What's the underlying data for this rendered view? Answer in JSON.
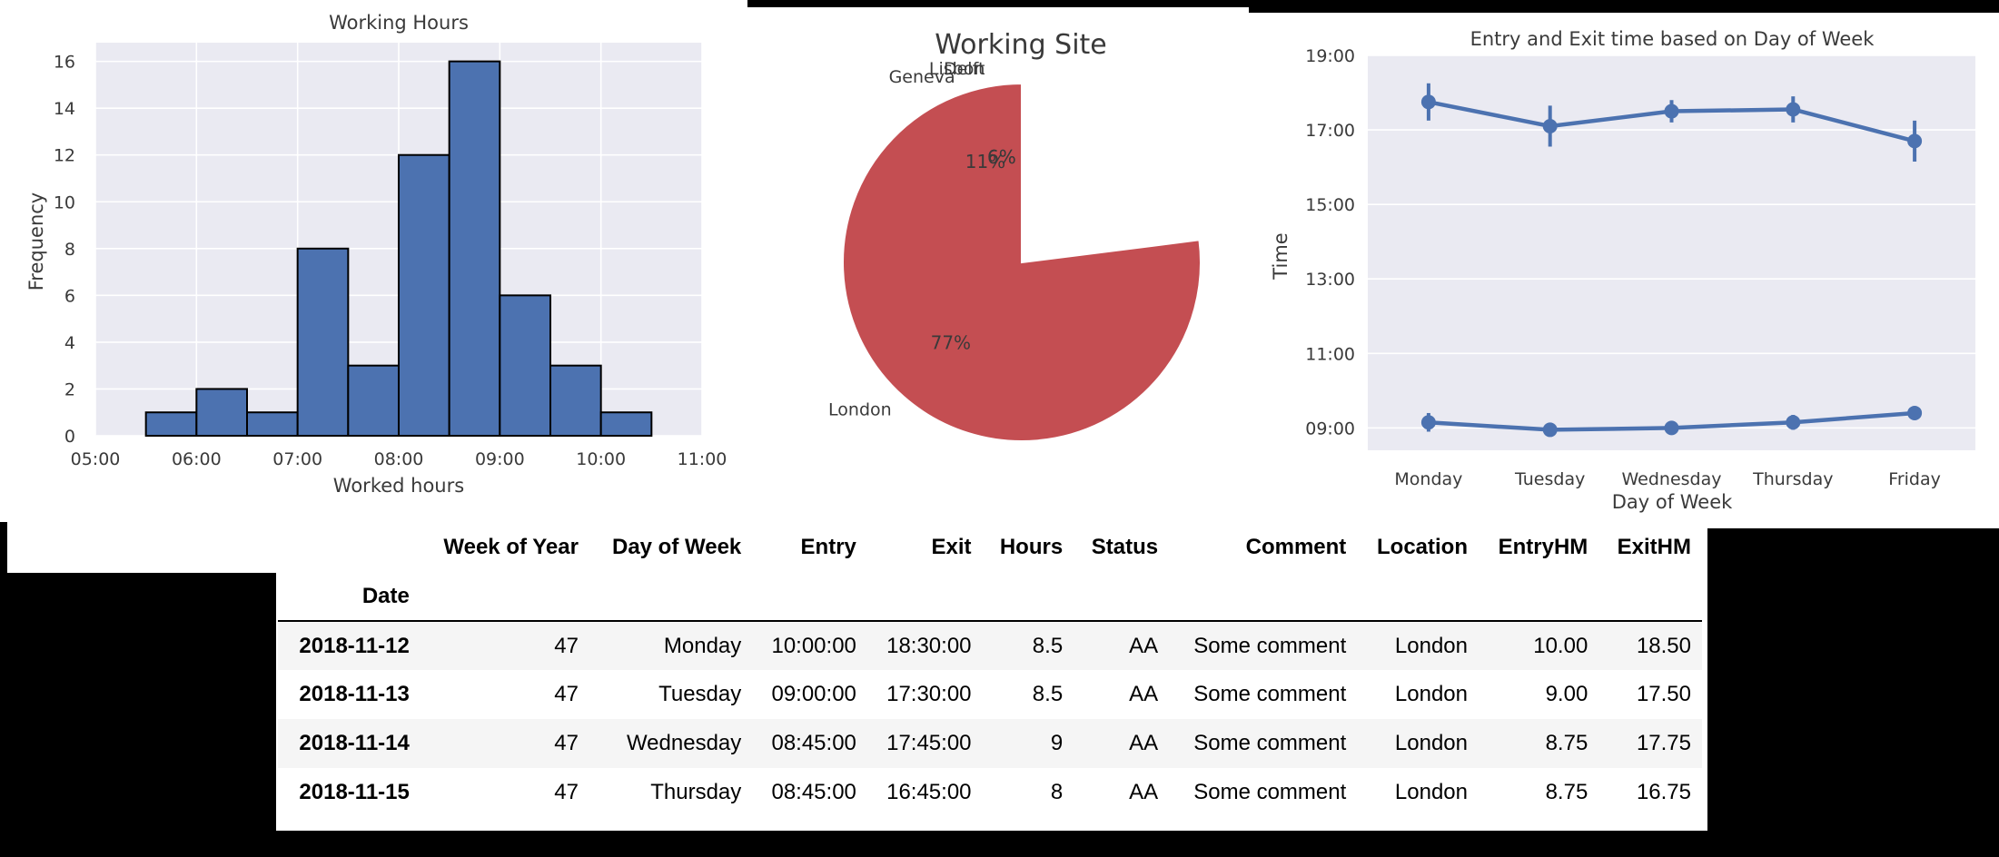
{
  "chart_data": [
    {
      "type": "bar",
      "title": "Working Hours",
      "xlabel": "Worked hours",
      "ylabel": "Frequency",
      "x_tick_labels": [
        "05:00",
        "06:00",
        "07:00",
        "08:00",
        "09:00",
        "10:00",
        "11:00"
      ],
      "y_tick_labels": [
        "0",
        "2",
        "4",
        "6",
        "8",
        "10",
        "12",
        "14",
        "16"
      ],
      "xlim": [
        5,
        11
      ],
      "ylim": [
        0,
        16.8
      ],
      "grid": true,
      "bins": [
        {
          "start": 5.5,
          "end": 6.0,
          "value": 1
        },
        {
          "start": 6.0,
          "end": 6.5,
          "value": 2
        },
        {
          "start": 6.5,
          "end": 7.0,
          "value": 1
        },
        {
          "start": 7.0,
          "end": 7.5,
          "value": 8
        },
        {
          "start": 7.5,
          "end": 8.0,
          "value": 3
        },
        {
          "start": 8.0,
          "end": 8.5,
          "value": 12
        },
        {
          "start": 8.5,
          "end": 9.0,
          "value": 16
        },
        {
          "start": 9.0,
          "end": 9.5,
          "value": 6
        },
        {
          "start": 9.5,
          "end": 10.0,
          "value": 3
        },
        {
          "start": 10.0,
          "end": 10.5,
          "value": 1
        }
      ],
      "colors": {
        "bar": "#4c72b0",
        "edge": "#000000",
        "plot_bg": "#eaeaf2",
        "grid": "#ffffff"
      }
    },
    {
      "type": "pie",
      "title": "Working Site",
      "slices": [
        {
          "label": "Delft",
          "value": 6,
          "pct_label": "6%",
          "color": "#4c72b0"
        },
        {
          "label": "Geneva",
          "value": 11,
          "pct_label": "11%",
          "color": "#dd8452"
        },
        {
          "label": "Lisbon",
          "value": 6,
          "pct_label": "6%",
          "color": "#55a868"
        },
        {
          "label": "London",
          "value": 77,
          "pct_label": "77%",
          "color": "#c44e52"
        }
      ]
    },
    {
      "type": "line",
      "title": "Entry and Exit time based on Day of Week",
      "xlabel": "Day of Week",
      "ylabel": "Time",
      "categories": [
        "Monday",
        "Tuesday",
        "Wednesday",
        "Thursday",
        "Friday"
      ],
      "y_tick_labels": [
        "09:00",
        "11:00",
        "13:00",
        "15:00",
        "17:00",
        "19:00"
      ],
      "ylim": [
        8.4,
        19.0
      ],
      "grid": true,
      "series": [
        {
          "values": [
            17.75,
            17.1,
            17.5,
            17.55,
            16.7
          ],
          "errors": [
            0.5,
            0.55,
            0.3,
            0.35,
            0.55
          ]
        },
        {
          "values": [
            9.15,
            8.95,
            9.0,
            9.15,
            9.4
          ],
          "errors": [
            0.25,
            0.1,
            0.12,
            0.2,
            0.15
          ]
        }
      ],
      "colors": {
        "line": "#4c72b0",
        "plot_bg": "#eaeaf2",
        "grid": "#ffffff"
      }
    }
  ],
  "table": {
    "columns": [
      "Week of Year",
      "Day of Week",
      "Entry",
      "Exit",
      "Hours",
      "Status",
      "Comment",
      "Location",
      "EntryHM",
      "ExitHM"
    ],
    "index_name": "Date",
    "rows": [
      {
        "index": "2018-11-12",
        "cells": [
          "47",
          "Monday",
          "10:00:00",
          "18:30:00",
          "8.5",
          "AA",
          "Some comment",
          "London",
          "10.00",
          "18.50"
        ]
      },
      {
        "index": "2018-11-13",
        "cells": [
          "47",
          "Tuesday",
          "09:00:00",
          "17:30:00",
          "8.5",
          "AA",
          "Some comment",
          "London",
          "9.00",
          "17.50"
        ]
      },
      {
        "index": "2018-11-14",
        "cells": [
          "47",
          "Wednesday",
          "08:45:00",
          "17:45:00",
          "9",
          "AA",
          "Some comment",
          "London",
          "8.75",
          "17.75"
        ]
      },
      {
        "index": "2018-11-15",
        "cells": [
          "47",
          "Thursday",
          "08:45:00",
          "16:45:00",
          "8",
          "AA",
          "Some comment",
          "London",
          "8.75",
          "16.75"
        ]
      }
    ]
  }
}
